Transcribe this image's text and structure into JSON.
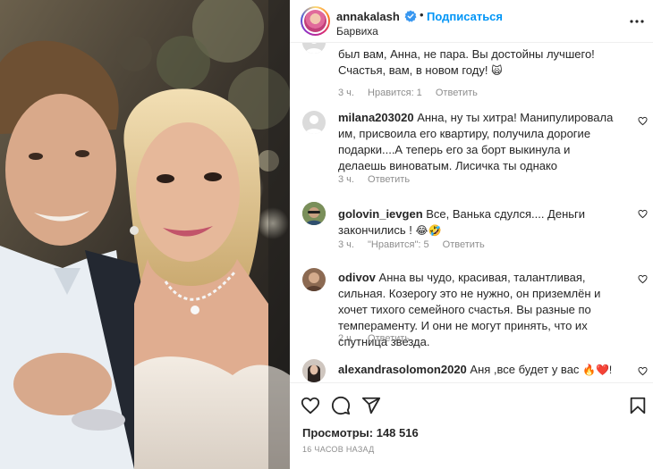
{
  "post": {
    "username": "annakalash",
    "follow_label": "Подписаться",
    "dot": "•",
    "location": "Барвиха"
  },
  "comments": [
    {
      "username": "",
      "text": "был вам, Анна, не пара. Вы достойны лучшего! Счастья, вам, в новом году!",
      "emoji": "🙀",
      "time": "3 ч.",
      "likes": "Нравится: 1",
      "reply": "Ответить"
    },
    {
      "username": "milana203020",
      "text": "Анна, ну ты хитра! Манипулировала им, присвоила его квартиру, получила дорогие подарки....А теперь его за борт выкинула и делаешь виноватым. Лисичка ты однако",
      "time": "3 ч.",
      "reply": "Ответить"
    },
    {
      "username": "golovin_ievgen",
      "text": "Все, Ванька сдулся.... Деньги закончились !",
      "emoji": "😂🤣",
      "time": "3 ч.",
      "likes": "\"Нравится\": 5",
      "reply": "Ответить"
    },
    {
      "username": "odivov",
      "text": "Анна вы чудо, красивая, талантливая, сильная. Козерогу это не нужно, он приземлён и хочет тихого семейного счастья. Вы разные по темпераменту. И они не могут принять, что их спутница звезда.",
      "time": "2 ч.",
      "reply": "Ответить"
    },
    {
      "username": "alexandrasolomon2020",
      "text": "Аня ,все будет у вас",
      "emoji": "🔥❤️!"
    }
  ],
  "footer": {
    "views_label": "Просмотры:",
    "views_count": "148 516",
    "time_ago": "16 ЧАСОВ НАЗАД"
  },
  "icons": {
    "verified": "verified-badge-icon",
    "more": "more-options-icon",
    "like": "heart-icon",
    "comment": "comment-icon",
    "share": "share-icon",
    "save": "bookmark-icon"
  },
  "colors": {
    "accent": "#0095f6",
    "secondary_text": "#8e8e8e",
    "text": "#262626"
  }
}
